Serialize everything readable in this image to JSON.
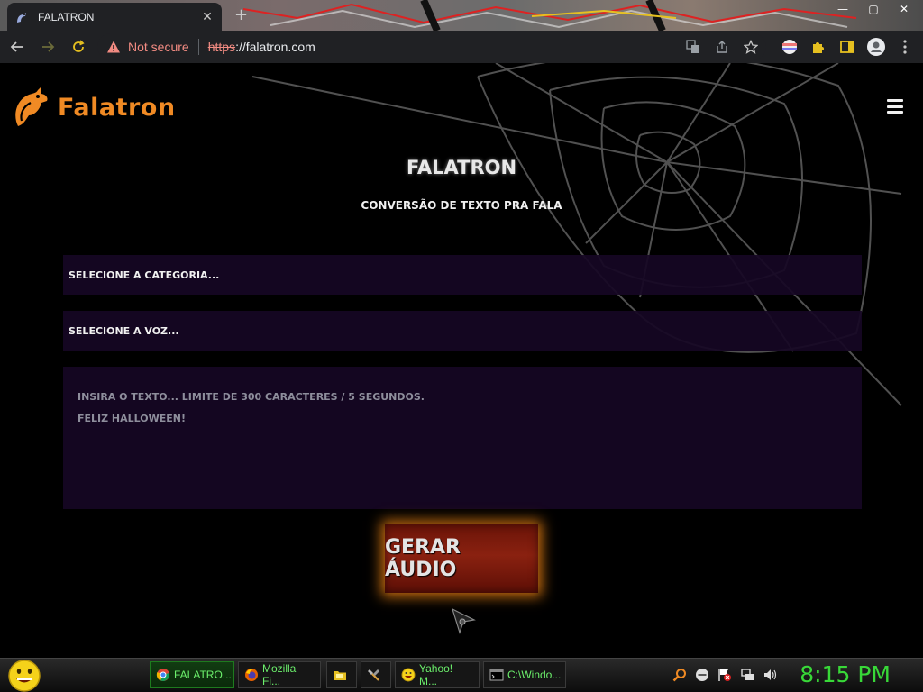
{
  "browser": {
    "tab_title": "FALATRON",
    "tab_close": "✕",
    "new_tab": "+",
    "security_label": "Not secure",
    "url_protocol": "https",
    "url_rest": "://falatron.com"
  },
  "window_controls": {
    "minimize": "—",
    "maximize": "▢",
    "close": "✕"
  },
  "page": {
    "brand": "Falatron",
    "title": "FALATRON",
    "subtitle": "CONVERSÃO DE TEXTO PRA FALA",
    "category_select": "SELECIONE A CATEGORIA...",
    "voice_select": "SELECIONE A VOZ...",
    "textarea_placeholder": "INSIRA O TEXTO... LIMITE DE 300 CARACTERES / 5 SEGUNDOS.",
    "textarea_line2": "FELIZ HALLOWEEN!",
    "generate_button": "GERAR ÁUDIO"
  },
  "taskbar": {
    "tasks": [
      {
        "label": "FALATRO...",
        "icon": "chrome-icon",
        "active": true
      },
      {
        "label": "Mozilla Fi...",
        "icon": "firefox-icon",
        "active": false
      },
      {
        "label": "",
        "icon": "folder-icon",
        "active": false
      },
      {
        "label": "",
        "icon": "tools-icon",
        "active": false
      },
      {
        "label": "Yahoo! M...",
        "icon": "yahoo-messenger-icon",
        "active": false
      },
      {
        "label": "C:\\Windo...",
        "icon": "cmd-icon",
        "active": false
      }
    ],
    "clock": "8:15 PM"
  },
  "colors": {
    "brand_orange": "#f08a24",
    "field_bg": "#160624",
    "button_glow": "#ff8c14",
    "clock_green": "#38d838",
    "not_secure_red": "#f28b82"
  }
}
